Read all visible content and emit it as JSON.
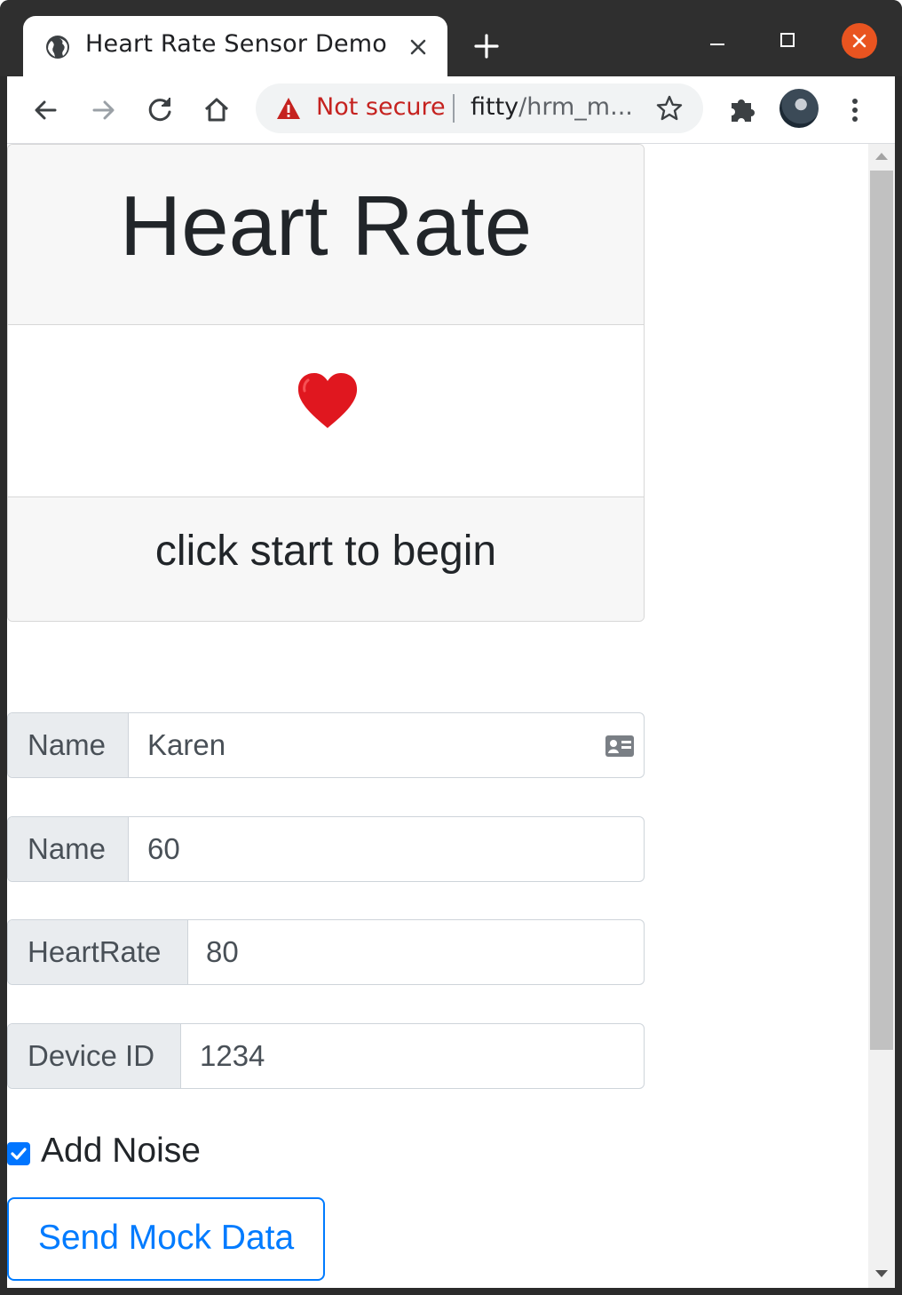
{
  "browser": {
    "tab_title": "Heart Rate Sensor Demo",
    "security_label": "Not secure",
    "url_host": "fitty",
    "url_rest": "/hrm_m..."
  },
  "card": {
    "title": "Heart Rate",
    "heart_glyph": "♥",
    "status": "click start to begin"
  },
  "form": {
    "fields": [
      {
        "label": "Name",
        "value": "Karen",
        "has_contact_icon": true
      },
      {
        "label": "Name",
        "value": "60"
      },
      {
        "label": "HeartRate",
        "value": "80"
      },
      {
        "label": "Device ID",
        "value": "1234"
      }
    ],
    "add_noise_label": "Add Noise",
    "add_noise_checked": true,
    "send_button": "Send Mock Data"
  },
  "colors": {
    "accent": "#007bff",
    "heart": "#e0171f",
    "warning": "#c5221f",
    "close_button": "#e95420"
  },
  "icons": [
    "globe-icon",
    "close-tab-icon",
    "plus-icon",
    "minimize-icon",
    "maximize-icon",
    "close-window-icon",
    "back-icon",
    "forward-icon",
    "reload-icon",
    "home-icon",
    "warning-icon",
    "star-icon",
    "puzzle-icon",
    "avatar",
    "more-icon",
    "heart-icon",
    "contact-card-icon"
  ]
}
